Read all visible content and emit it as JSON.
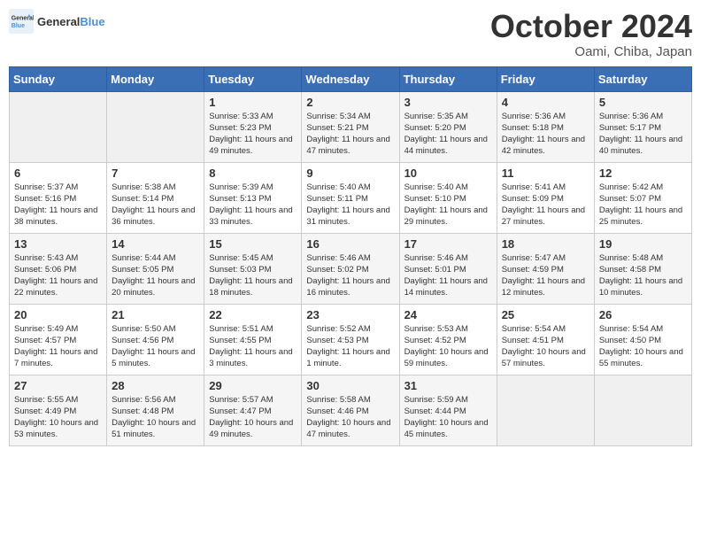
{
  "logo": {
    "text_general": "General",
    "text_blue": "Blue"
  },
  "header": {
    "month": "October 2024",
    "location": "Oami, Chiba, Japan"
  },
  "days_of_week": [
    "Sunday",
    "Monday",
    "Tuesday",
    "Wednesday",
    "Thursday",
    "Friday",
    "Saturday"
  ],
  "weeks": [
    [
      {
        "day": "",
        "info": ""
      },
      {
        "day": "",
        "info": ""
      },
      {
        "day": "1",
        "info": "Sunrise: 5:33 AM\nSunset: 5:23 PM\nDaylight: 11 hours and 49 minutes."
      },
      {
        "day": "2",
        "info": "Sunrise: 5:34 AM\nSunset: 5:21 PM\nDaylight: 11 hours and 47 minutes."
      },
      {
        "day": "3",
        "info": "Sunrise: 5:35 AM\nSunset: 5:20 PM\nDaylight: 11 hours and 44 minutes."
      },
      {
        "day": "4",
        "info": "Sunrise: 5:36 AM\nSunset: 5:18 PM\nDaylight: 11 hours and 42 minutes."
      },
      {
        "day": "5",
        "info": "Sunrise: 5:36 AM\nSunset: 5:17 PM\nDaylight: 11 hours and 40 minutes."
      }
    ],
    [
      {
        "day": "6",
        "info": "Sunrise: 5:37 AM\nSunset: 5:16 PM\nDaylight: 11 hours and 38 minutes."
      },
      {
        "day": "7",
        "info": "Sunrise: 5:38 AM\nSunset: 5:14 PM\nDaylight: 11 hours and 36 minutes."
      },
      {
        "day": "8",
        "info": "Sunrise: 5:39 AM\nSunset: 5:13 PM\nDaylight: 11 hours and 33 minutes."
      },
      {
        "day": "9",
        "info": "Sunrise: 5:40 AM\nSunset: 5:11 PM\nDaylight: 11 hours and 31 minutes."
      },
      {
        "day": "10",
        "info": "Sunrise: 5:40 AM\nSunset: 5:10 PM\nDaylight: 11 hours and 29 minutes."
      },
      {
        "day": "11",
        "info": "Sunrise: 5:41 AM\nSunset: 5:09 PM\nDaylight: 11 hours and 27 minutes."
      },
      {
        "day": "12",
        "info": "Sunrise: 5:42 AM\nSunset: 5:07 PM\nDaylight: 11 hours and 25 minutes."
      }
    ],
    [
      {
        "day": "13",
        "info": "Sunrise: 5:43 AM\nSunset: 5:06 PM\nDaylight: 11 hours and 22 minutes."
      },
      {
        "day": "14",
        "info": "Sunrise: 5:44 AM\nSunset: 5:05 PM\nDaylight: 11 hours and 20 minutes."
      },
      {
        "day": "15",
        "info": "Sunrise: 5:45 AM\nSunset: 5:03 PM\nDaylight: 11 hours and 18 minutes."
      },
      {
        "day": "16",
        "info": "Sunrise: 5:46 AM\nSunset: 5:02 PM\nDaylight: 11 hours and 16 minutes."
      },
      {
        "day": "17",
        "info": "Sunrise: 5:46 AM\nSunset: 5:01 PM\nDaylight: 11 hours and 14 minutes."
      },
      {
        "day": "18",
        "info": "Sunrise: 5:47 AM\nSunset: 4:59 PM\nDaylight: 11 hours and 12 minutes."
      },
      {
        "day": "19",
        "info": "Sunrise: 5:48 AM\nSunset: 4:58 PM\nDaylight: 11 hours and 10 minutes."
      }
    ],
    [
      {
        "day": "20",
        "info": "Sunrise: 5:49 AM\nSunset: 4:57 PM\nDaylight: 11 hours and 7 minutes."
      },
      {
        "day": "21",
        "info": "Sunrise: 5:50 AM\nSunset: 4:56 PM\nDaylight: 11 hours and 5 minutes."
      },
      {
        "day": "22",
        "info": "Sunrise: 5:51 AM\nSunset: 4:55 PM\nDaylight: 11 hours and 3 minutes."
      },
      {
        "day": "23",
        "info": "Sunrise: 5:52 AM\nSunset: 4:53 PM\nDaylight: 11 hours and 1 minute."
      },
      {
        "day": "24",
        "info": "Sunrise: 5:53 AM\nSunset: 4:52 PM\nDaylight: 10 hours and 59 minutes."
      },
      {
        "day": "25",
        "info": "Sunrise: 5:54 AM\nSunset: 4:51 PM\nDaylight: 10 hours and 57 minutes."
      },
      {
        "day": "26",
        "info": "Sunrise: 5:54 AM\nSunset: 4:50 PM\nDaylight: 10 hours and 55 minutes."
      }
    ],
    [
      {
        "day": "27",
        "info": "Sunrise: 5:55 AM\nSunset: 4:49 PM\nDaylight: 10 hours and 53 minutes."
      },
      {
        "day": "28",
        "info": "Sunrise: 5:56 AM\nSunset: 4:48 PM\nDaylight: 10 hours and 51 minutes."
      },
      {
        "day": "29",
        "info": "Sunrise: 5:57 AM\nSunset: 4:47 PM\nDaylight: 10 hours and 49 minutes."
      },
      {
        "day": "30",
        "info": "Sunrise: 5:58 AM\nSunset: 4:46 PM\nDaylight: 10 hours and 47 minutes."
      },
      {
        "day": "31",
        "info": "Sunrise: 5:59 AM\nSunset: 4:44 PM\nDaylight: 10 hours and 45 minutes."
      },
      {
        "day": "",
        "info": ""
      },
      {
        "day": "",
        "info": ""
      }
    ]
  ]
}
